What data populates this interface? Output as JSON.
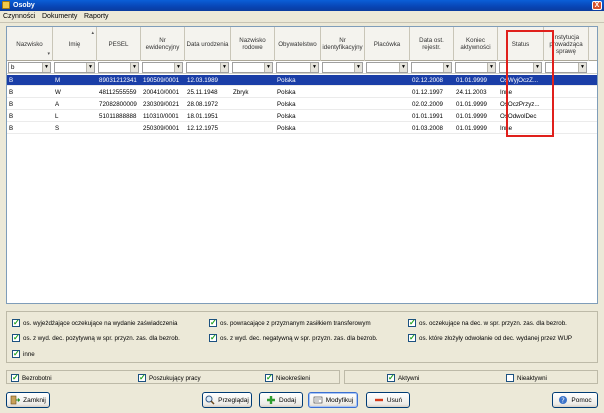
{
  "window": {
    "title": "Osoby",
    "close_label": "X"
  },
  "menu": [
    "Czynności",
    "Dokumenty",
    "Raporty"
  ],
  "columns": [
    {
      "label": "Nazwisko",
      "width": 46
    },
    {
      "label": "Imię",
      "width": 44
    },
    {
      "label": "PESEL",
      "width": 44
    },
    {
      "label": "Nr ewidencyjny",
      "width": 44
    },
    {
      "label": "Data urodzenia",
      "width": 46
    },
    {
      "label": "Nazwisko rodowe",
      "width": 44
    },
    {
      "label": "Obywatelstwo",
      "width": 46
    },
    {
      "label": "Nr identyfikacyjny",
      "width": 44
    },
    {
      "label": "Placówka",
      "width": 45
    },
    {
      "label": "Data ost. rejestr.",
      "width": 44
    },
    {
      "label": "Koniec aktywności",
      "width": 44
    },
    {
      "label": "Status",
      "width": 46
    },
    {
      "label": "Instytucja prowadząca sprawę",
      "width": 45
    }
  ],
  "filters": [
    "b",
    "",
    "",
    "",
    "",
    "",
    "",
    "",
    "",
    "",
    "",
    "",
    ""
  ],
  "rows": [
    [
      "B",
      "M",
      "89031212341",
      "190509/0001",
      "12.03.1989",
      "",
      "Polska",
      "",
      "",
      "02.12.2008",
      "01.01.9999",
      "OsWyjOczZ...",
      ""
    ],
    [
      "B",
      "W",
      "48112555559",
      "200410/0001",
      "25.11.1948",
      "Zbryk",
      "Polska",
      "",
      "",
      "01.12.1997",
      "24.11.2003",
      "Inne",
      ""
    ],
    [
      "B",
      "A",
      "72082800009",
      "230309/0021",
      "28.08.1972",
      "",
      "Polska",
      "",
      "",
      "02.02.2009",
      "01.01.9999",
      "OsOczPrzyz...",
      ""
    ],
    [
      "B",
      "L",
      "51011888888",
      "110310/0001",
      "18.01.1951",
      "",
      "Polska",
      "",
      "",
      "01.01.1991",
      "01.01.9999",
      "OsOdwolDec",
      ""
    ],
    [
      "B",
      "S",
      "",
      "250309/0001",
      "12.12.1975",
      "",
      "Polska",
      "",
      "",
      "01.03.2008",
      "01.01.9999",
      "Inne",
      ""
    ]
  ],
  "status_checks": [
    {
      "label": "os. wyjeżdżające oczekujące na wydanie zaświadczenia",
      "checked": true
    },
    {
      "label": "os. powracające z przyznanym zasiłkiem transferowym",
      "checked": true
    },
    {
      "label": "os. oczekujące na dec. w spr. przyzn. zas. dla bezrob.",
      "checked": true
    },
    {
      "label": "os. z wyd. dec. pozytywną w spr. przyzn. zas. dla bezrob.",
      "checked": true
    },
    {
      "label": "os. z wyd. dec. negatywną w spr. przyzn. zas. dla bezrob.",
      "checked": true
    },
    {
      "label": "os. które złożyły odwołanie od dec. wydanej przez WUP",
      "checked": true
    },
    {
      "label": "inne",
      "checked": true
    }
  ],
  "type_filters": [
    {
      "label": "Bezrobotni",
      "checked": true
    },
    {
      "label": "Poszukujący pracy",
      "checked": true
    },
    {
      "label": "Nieokreśleni",
      "checked": true
    },
    {
      "label": "Aktywni",
      "checked": true
    },
    {
      "label": "Nieaktywni",
      "checked": false
    }
  ],
  "buttons": {
    "close": "Zamknij",
    "browse": "Przeglądaj",
    "add": "Dodaj",
    "modify": "Modyfikuj",
    "delete": "Usuń",
    "help": "Pomoc"
  },
  "colors": {
    "selection": "#1a3ea7",
    "highlight": "#e0201c",
    "titlebar": "#0845b5"
  }
}
